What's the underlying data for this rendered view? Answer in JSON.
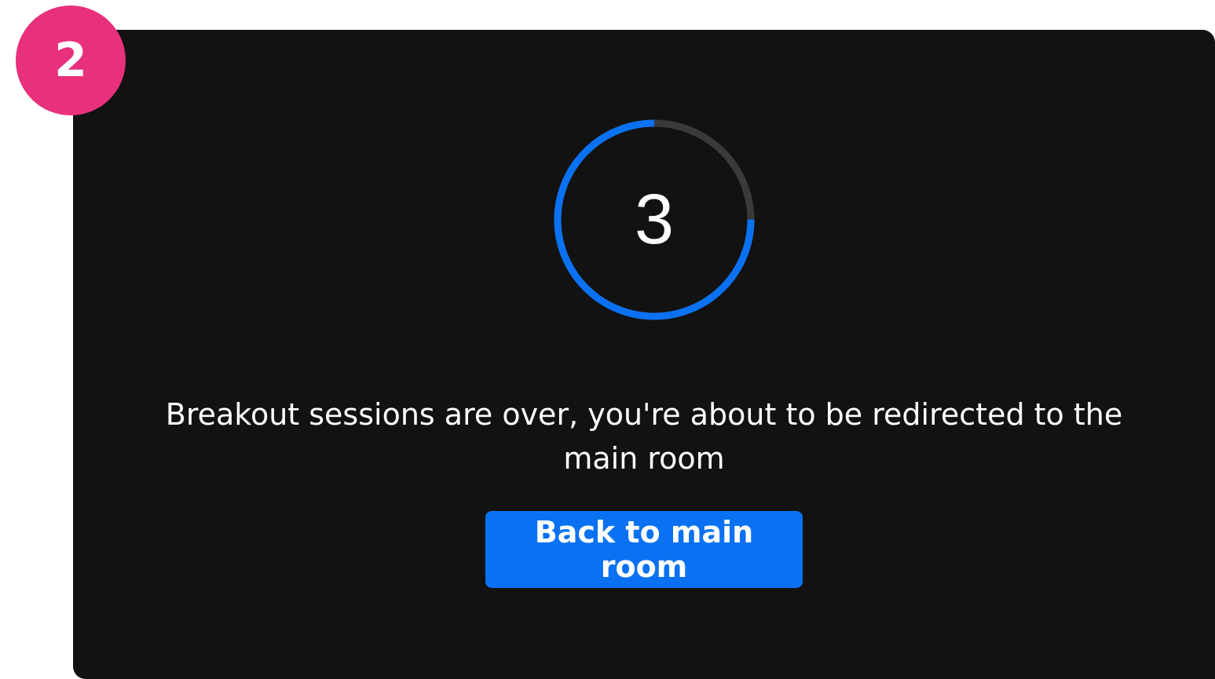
{
  "step_badge": {
    "number": "2",
    "color": "#e8307c"
  },
  "countdown": {
    "value": "3",
    "progress_fraction": 0.75,
    "progress_color": "#0a72f2",
    "track_color": "#3a3a3a"
  },
  "message": "Breakout sessions are over, you're about to be redirected to the main room",
  "button": {
    "label": "Back to main room",
    "color": "#0a72f2"
  }
}
